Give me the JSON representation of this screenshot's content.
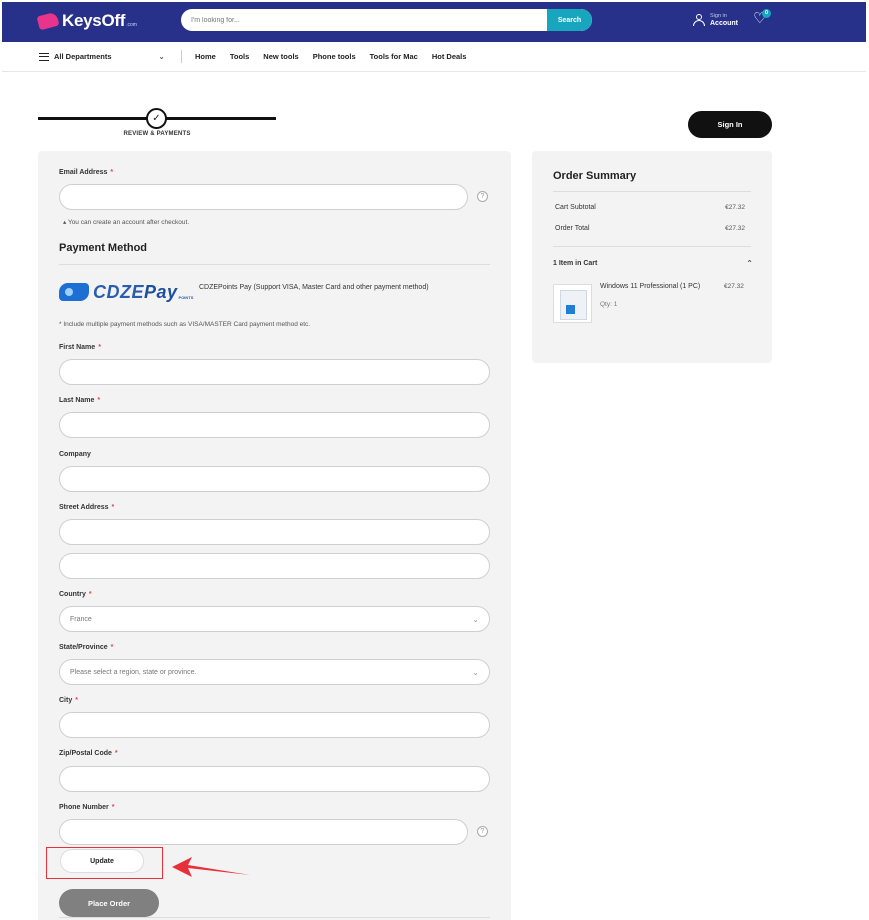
{
  "header": {
    "logo_text": "KeysOff",
    "logo_sub": ".com",
    "search_placeholder": "I'm looking for...",
    "search_button": "Search",
    "account_small": "Sign in",
    "account_big": "Account",
    "wishlist_count": "0",
    "colors": {
      "bar": "#28318a",
      "accent": "#18a6bf",
      "logo": "#e8348c"
    }
  },
  "nav": {
    "departments": "All Departments",
    "links": [
      "Home",
      "Tools",
      "New tools",
      "Phone tools",
      "Tools for Mac",
      "Hot Deals"
    ]
  },
  "stepper": {
    "check": "✓",
    "label": "REVIEW & PAYMENTS"
  },
  "signin_button": "Sign In",
  "form": {
    "email_label": "Email Address",
    "account_note": "You can create an account after checkout.",
    "payment_title": "Payment Method",
    "payment_logo_main": "CDZE",
    "payment_logo_pay": "Pay",
    "payment_logo_points": "POINTS",
    "payment_desc": "CDZEPoints Pay (Support VISA, Master Card and other payment method)",
    "payment_note": "* Include multiple payment methods such as VISA/MASTER Card payment method etc.",
    "first_name_label": "First Name",
    "last_name_label": "Last Name",
    "company_label": "Company",
    "street_label": "Street Address",
    "country_label": "Country",
    "country_value": "France",
    "state_label": "State/Province",
    "state_placeholder": "Please select a region, state or province.",
    "city_label": "City",
    "zip_label": "Zip/Postal Code",
    "phone_label": "Phone Number",
    "required_mark": "*",
    "help_mark": "?",
    "update_button": "Update",
    "place_order_button": "Place Order"
  },
  "summary": {
    "title": "Order Summary",
    "cart_subtotal_label": "Cart Subtotal",
    "cart_subtotal_value": "€27.32",
    "order_total_label": "Order Total",
    "order_total_value": "€27.32",
    "items_in_cart": "1 Item in Cart",
    "item": {
      "name": "Windows 11 Professional (1 PC)",
      "price": "€27.32",
      "qty": "Qty: 1"
    }
  }
}
